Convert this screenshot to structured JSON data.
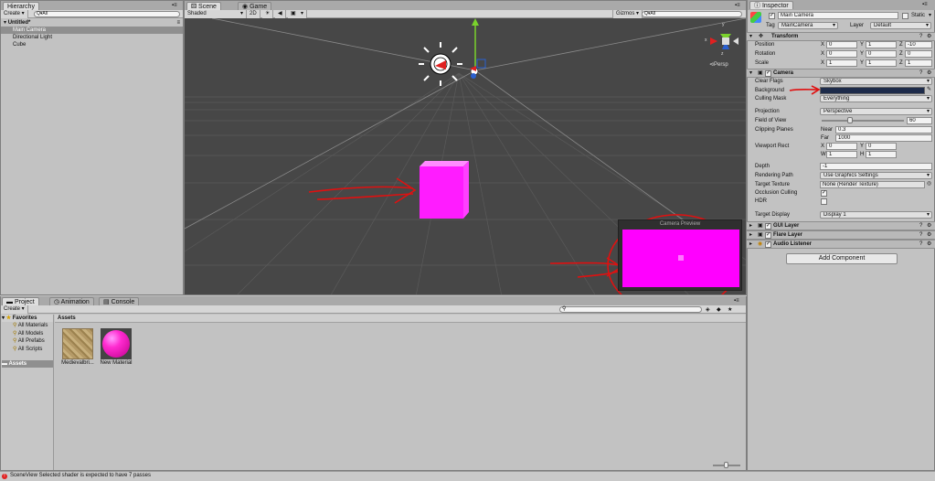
{
  "colors": {
    "accent_magenta": "#ff00ff",
    "annotation_red": "#e01010",
    "selection_gray": "#8f8f8f",
    "error_red": "#e02020"
  },
  "hierarchy": {
    "tab": "Hierarchy",
    "create": "Create",
    "search_prefix": "Q▾All",
    "scene_name": "Untitled*",
    "items": [
      "Main Camera",
      "Directional Light",
      "Cube"
    ]
  },
  "scene": {
    "tabs": [
      "Scene",
      "Game"
    ],
    "shading": "Shaded",
    "mode_2d": "2D",
    "gizmos": "Gizmos",
    "search_prefix": "Q▾All",
    "persp": "Persp",
    "camera_preview_title": "Camera Preview",
    "axis_y": "y",
    "axis_x": "x",
    "axis_z": "z"
  },
  "inspector": {
    "tab": "Inspector",
    "object_name": "Main Camera",
    "static_label": "Static",
    "tag_label": "Tag",
    "tag_value": "MainCamera",
    "layer_label": "Layer",
    "layer_value": "Default",
    "transform": {
      "title": "Transform",
      "position_label": "Position",
      "rotation_label": "Rotation",
      "scale_label": "Scale",
      "x": "X",
      "y": "Y",
      "z": "Z",
      "position": [
        "0",
        "1",
        "-10"
      ],
      "rotation": [
        "0",
        "0",
        "0"
      ],
      "scale": [
        "1",
        "1",
        "1"
      ]
    },
    "camera": {
      "title": "Camera",
      "clear_flags_label": "Clear Flags",
      "clear_flags": "Skybox",
      "background_label": "Background",
      "background_color": "#1d2b4a",
      "culling_mask_label": "Culling Mask",
      "culling_mask": "Everything",
      "projection_label": "Projection",
      "projection": "Perspective",
      "fov_label": "Field of View",
      "fov": "60",
      "fov_fraction": 0.33,
      "clipping_label": "Clipping Planes",
      "near_label": "Near",
      "near": "0.3",
      "far_label": "Far",
      "far": "1000",
      "viewport_label": "Viewport Rect",
      "vx_label": "X",
      "vx": "0",
      "vy_label": "Y",
      "vy": "0",
      "vw_label": "W",
      "vw": "1",
      "vh_label": "H",
      "vh": "1",
      "depth_label": "Depth",
      "depth": "-1",
      "render_path_label": "Rendering Path",
      "render_path": "Use Graphics Settings",
      "target_texture_label": "Target Texture",
      "target_texture": "None (Render Texture)",
      "occlusion_label": "Occlusion Culling",
      "hdr_label": "HDR",
      "target_display_label": "Target Display",
      "target_display": "Display 1"
    },
    "components": [
      "GUI Layer",
      "Flare Layer",
      "Audio Listener"
    ],
    "add_component": "Add Component"
  },
  "project": {
    "tabs": [
      "Project",
      "Animation",
      "Console"
    ],
    "create": "Create",
    "favorites": "Favorites",
    "favorite_items": [
      "All Materials",
      "All Models",
      "All Prefabs",
      "All Scripts"
    ],
    "assets_side": "Assets",
    "assets_header": "Assets",
    "assets": [
      "Medievalbri...",
      "New Material"
    ]
  },
  "status": {
    "message": "SceneView Selected shader is expected to have 7 passes"
  }
}
